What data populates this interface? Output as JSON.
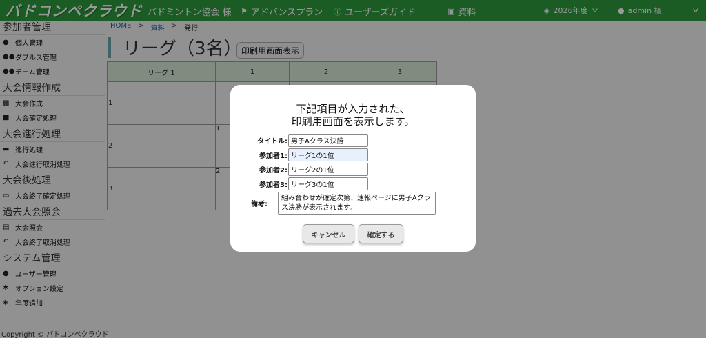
{
  "header": {
    "logo": "バドコンペクラウド",
    "association": "バドミントン協会 様",
    "advanced_plan": "アドバンスプラン",
    "user_guide": "ユーザーズガイド",
    "documents": "資料",
    "year": "2026年度",
    "user": "admin 様"
  },
  "sidebar": {
    "sections": [
      {
        "title": "参加者管理",
        "items": [
          "個人管理",
          "ダブルス管理",
          "チーム管理"
        ]
      },
      {
        "title": "大会情報作成",
        "items": [
          "大会作成",
          "大会確定処理"
        ]
      },
      {
        "title": "大会進行処理",
        "items": [
          "進行処理",
          "大会進行取消処理"
        ]
      },
      {
        "title": "大会後処理",
        "items": [
          "大会終了確定処理"
        ]
      },
      {
        "title": "過去大会照会",
        "items": [
          "大会照会",
          "大会終了取消処理"
        ]
      },
      {
        "title": "システム管理",
        "items": [
          "ユーザー管理",
          "オプション設定",
          "年度追加"
        ]
      }
    ]
  },
  "breadcrumb": {
    "home": "HOME",
    "docs": "資料",
    "current": "発行",
    "sep": ">"
  },
  "page": {
    "title": "リーグ（3名）",
    "print_button": "印刷用画面表示"
  },
  "league_table": {
    "corner": "リーグ 1",
    "columns": [
      "1",
      "2",
      "3"
    ],
    "rows": [
      "1",
      "2",
      "3"
    ],
    "cell_r2c1": "1",
    "cell_r3c1": "2"
  },
  "modal": {
    "message_line1": "下記項目が入力された、",
    "message_line2": "印刷用画面を表示します。",
    "title_label": "タイトル:",
    "title_value": "男子Aクラス決勝",
    "p1_label": "参加者1:",
    "p1_value": "リーグ1の1位",
    "p2_label": "参加者2:",
    "p2_value": "リーグ2の1位",
    "p3_label": "参加者3:",
    "p3_value": "リーグ3の1位",
    "remarks_label": "備考:",
    "remarks_value": "組み合わせが確定次第、速報ページに男子Aクラス決勝が表示されます。",
    "cancel": "キャンセル",
    "confirm": "確定する"
  },
  "footer": {
    "copyright": "Copyright © バドコンペクラウド"
  },
  "colors": {
    "header_green": "#2d9a3f",
    "table_header": "#d6ead6",
    "title_accent": "#6aa6a8"
  }
}
